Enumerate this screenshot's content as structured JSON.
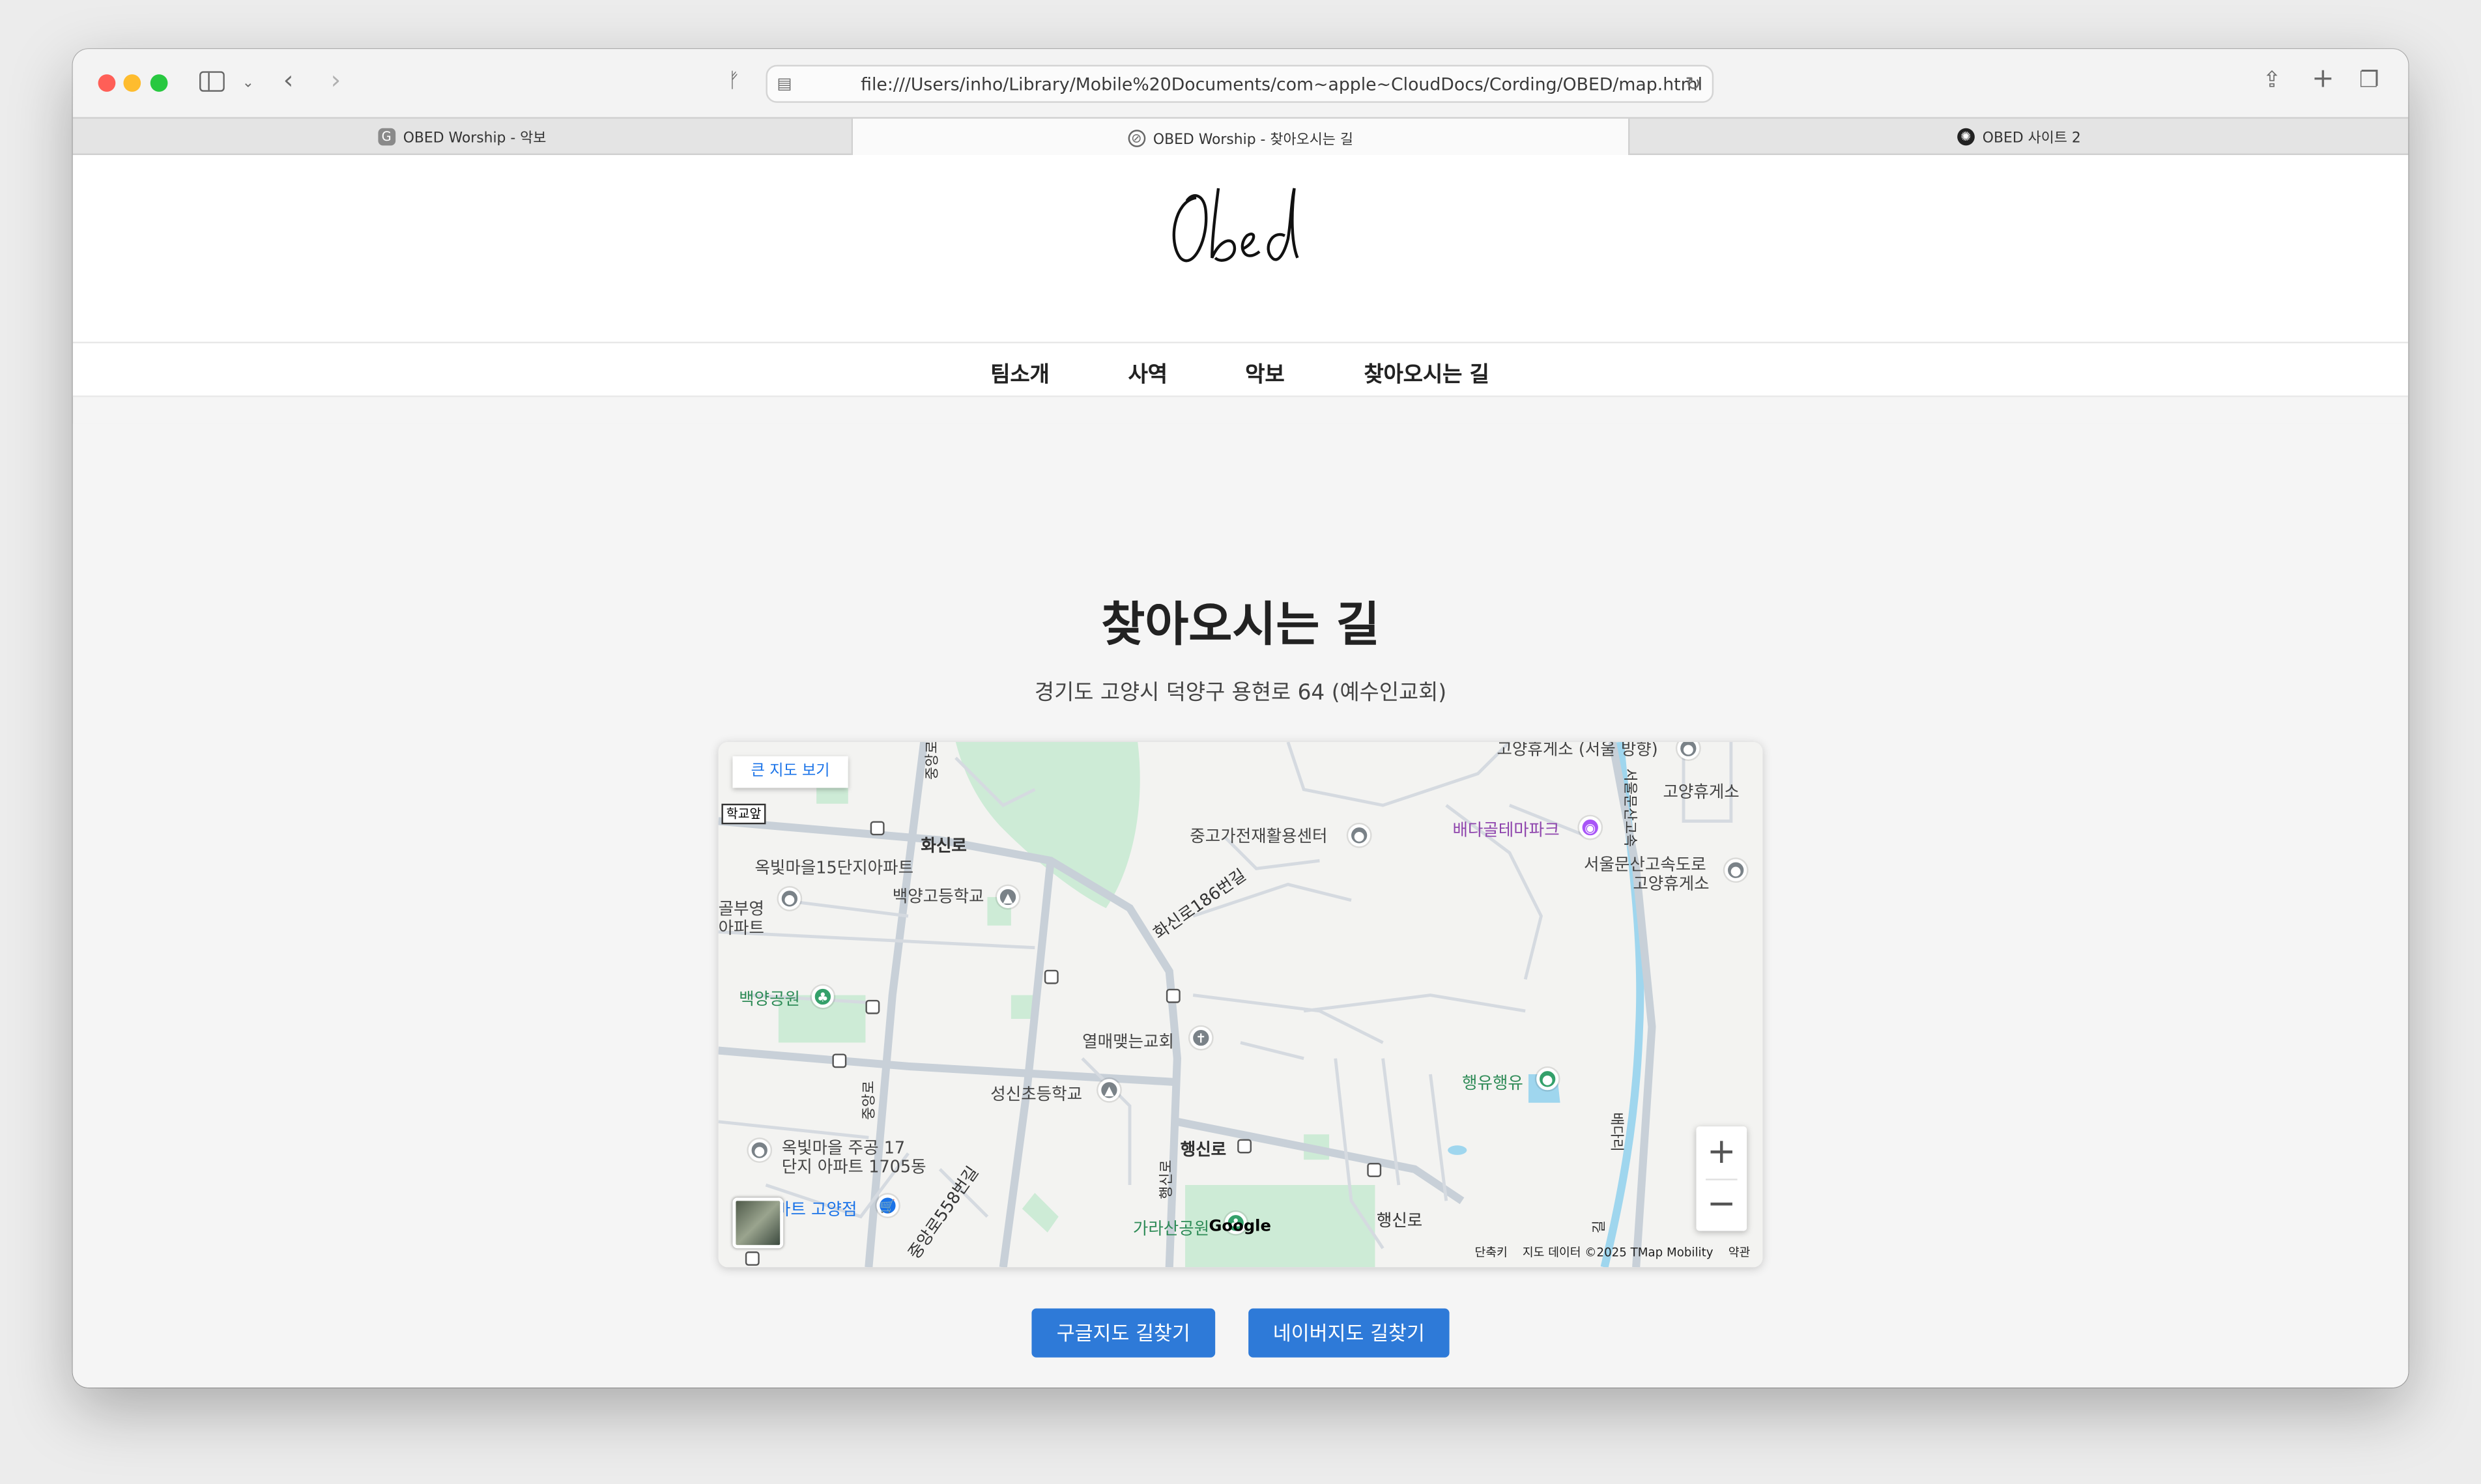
{
  "browser": {
    "url": "file:///Users/inho/Library/Mobile%20Documents/com~apple~CloudDocs/Cording/OBED/map.html",
    "tabs": [
      {
        "label": "OBED Worship - 악보",
        "favicon": "G"
      },
      {
        "label": "OBED Worship - 찾아오시는 길",
        "favicon": "compass"
      },
      {
        "label": "OBED 사이트 2",
        "favicon": "openai"
      }
    ]
  },
  "site": {
    "logo_text": "Obed",
    "nav": [
      "팀소개",
      "사역",
      "악보",
      "찾아오시는 길"
    ]
  },
  "main": {
    "title": "찾아오시는 길",
    "address": "경기도 고양시 덕양구 용현로 64 (예수인교회)"
  },
  "map": {
    "big_map_button": "큰 지도 보기",
    "labels": {
      "hwasin_ro": "화신로",
      "okbit15": "옥빛마을15단지아파트",
      "baekyang_hs": "백양고등학교",
      "baekyang_park": "백양공원",
      "used_center": "중고가전재활용센터",
      "baedagol": "배다골테마파크",
      "rest_area": "서울문산고속도로",
      "rest_area2": "고양휴게소",
      "rest_area_top": "고양휴게소 (서울 방향)",
      "goyang_rest": "고양휴게소",
      "yeolmae": "열매맺는교회",
      "seongsin": "성신초등학교",
      "haengyu": "행유행유",
      "haengsin_ro": "행신로",
      "haengsin_ro2": "행신로",
      "garasan": "가라산공원",
      "okbit17_1": "옥빛마을 주공 17",
      "okbit17_2": "단지 아파트 1705동",
      "mart": "마트 고양점",
      "hwasin186": "화신로186번길",
      "jungang558": "중앙로558번길",
      "school_front": "학교앞",
      "left1": "골부영",
      "left2": "아파트",
      "jungang_ro": "중앙로",
      "jungang_ro_top": "중앙로",
      "haengsin_ro_v": "행신로",
      "expressway_v": "서울문산고속",
      "baedari": "배다리",
      "gil": "길"
    },
    "attribution": {
      "shortcuts": "단축키",
      "data": "지도 데이터 ©2025 TMap Mobility",
      "terms": "약관"
    },
    "zoom_in": "+",
    "zoom_out": "−",
    "google_logo": "Google"
  },
  "buttons": {
    "google": "구글지도 길찾기",
    "naver": "네이버지도 길찾기"
  },
  "colors": {
    "accent": "#2e7ad8",
    "park": "#c9ead3",
    "water": "#9fd6ee"
  }
}
